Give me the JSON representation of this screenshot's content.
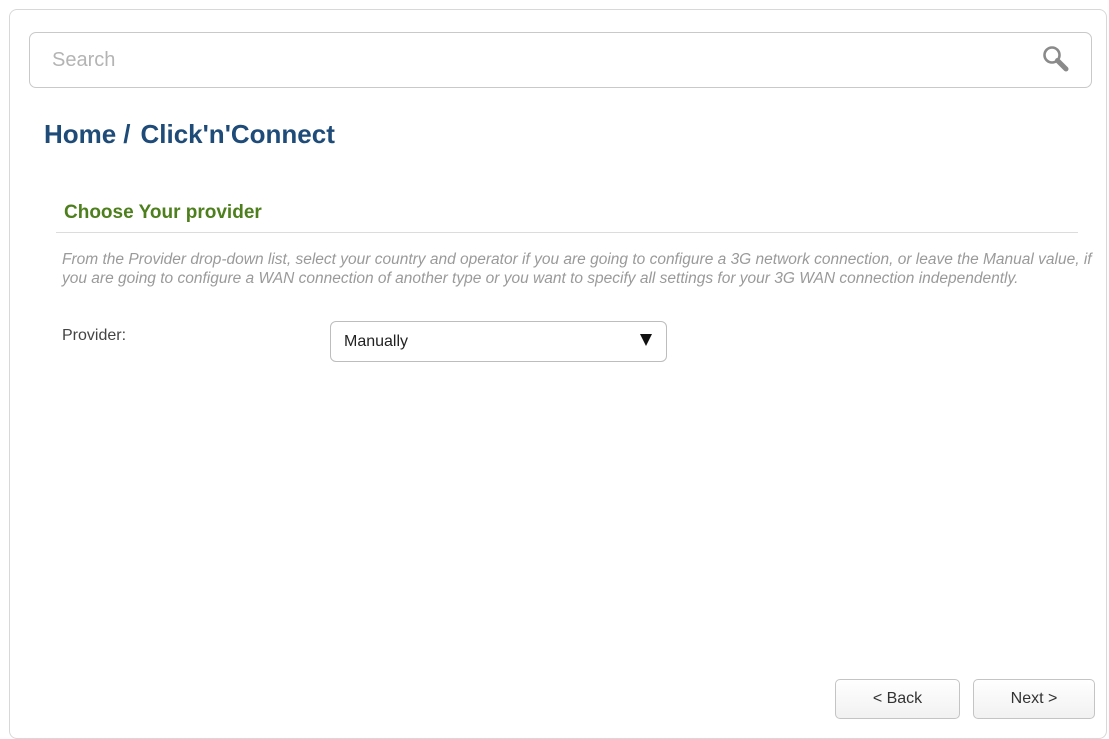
{
  "search": {
    "placeholder": "Search",
    "icon": "search-icon"
  },
  "breadcrumb": {
    "home": "Home",
    "separator": "/",
    "current": "Click'n'Connect"
  },
  "section": {
    "title": "Choose Your provider",
    "description": "From the Provider drop-down list, select your country and operator if you are going to configure a 3G network connection, or leave the Manual value, if you are going to configure a WAN connection of another type or you want to specify all settings for your 3G WAN connection independently."
  },
  "provider": {
    "label": "Provider:",
    "selected": "Manually"
  },
  "buttons": {
    "back": "< Back",
    "next": "Next >"
  },
  "colors": {
    "breadcrumb": "#1e4b78",
    "section_title": "#4d7f1c",
    "description": "#9a9a9a"
  }
}
